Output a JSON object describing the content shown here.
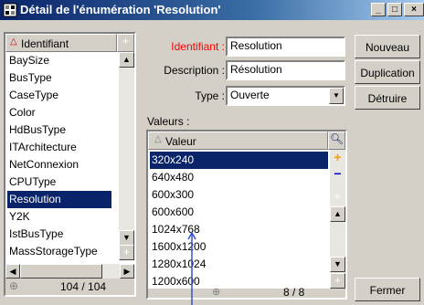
{
  "window": {
    "title": "Détail de l'énumération 'Resolution'",
    "controls": [
      "_",
      "□",
      "×"
    ]
  },
  "enum_list": {
    "header": "Identifiant",
    "items": [
      "BaySize",
      "BusType",
      "CaseType",
      "Color",
      "HdBusType",
      "ITArchitecture",
      "NetConnexion",
      "CPUType",
      "Resolution",
      "Y2K",
      "IstBusType",
      "MassStorageType"
    ],
    "selected": "Resolution",
    "counter": "104 / 104"
  },
  "form": {
    "id_label": "Identifiant :",
    "id_value": "Resolution",
    "desc_label": "Description :",
    "desc_value": "Résolution",
    "type_label": "Type :",
    "type_value": "Ouverte",
    "values_label": "Valeurs :"
  },
  "values_list": {
    "header": "Valeur",
    "items": [
      "320x240",
      "640x480",
      "600x300",
      "600x600",
      "1024x768",
      "1600x1200",
      "1280x1024",
      "1200x600"
    ],
    "selected": "320x240",
    "counter": "8 / 8"
  },
  "buttons": {
    "new": "Nouveau",
    "duplicate": "Duplication",
    "delete": "Détruire",
    "close": "Fermer"
  },
  "colors": {
    "accent": "#0a246a",
    "required_label": "#ff0000"
  }
}
